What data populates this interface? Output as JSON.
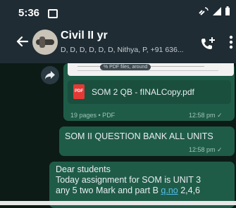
{
  "status_bar": {
    "time": "5:36"
  },
  "header": {
    "title": "Civil II yr",
    "subtitle": "D, D, D, D, D, D, Nithya, P, +91 636..."
  },
  "messages": [
    {
      "type": "document",
      "preview_tooltip": "% PDF files, around",
      "file_name": "SOM 2 QB - fINALCopy.pdf",
      "meta": "19 pages • PDF",
      "time": "12:58 pm ✓"
    },
    {
      "type": "text",
      "text": "SOM II QUESTION BANK ALL UNITS",
      "time": "12:58 pm ✓"
    },
    {
      "type": "text",
      "line1": "Dear students",
      "line2": "Today assignment for SOM is UNIT 3",
      "line3_prefix": "any 5 two Mark and part B ",
      "line3_link": "q.no",
      "line3_suffix": " 2,4,6"
    }
  ],
  "icons": {
    "back": "arrow-left-icon",
    "call": "add-call-icon",
    "more": "more-vertical-icon",
    "share": "forward-icon",
    "pdf": "pdf-file-icon"
  },
  "colors": {
    "app_bar": "#1f2c34",
    "outgoing_bubble": "#1f5c48",
    "link": "#53bdeb"
  }
}
